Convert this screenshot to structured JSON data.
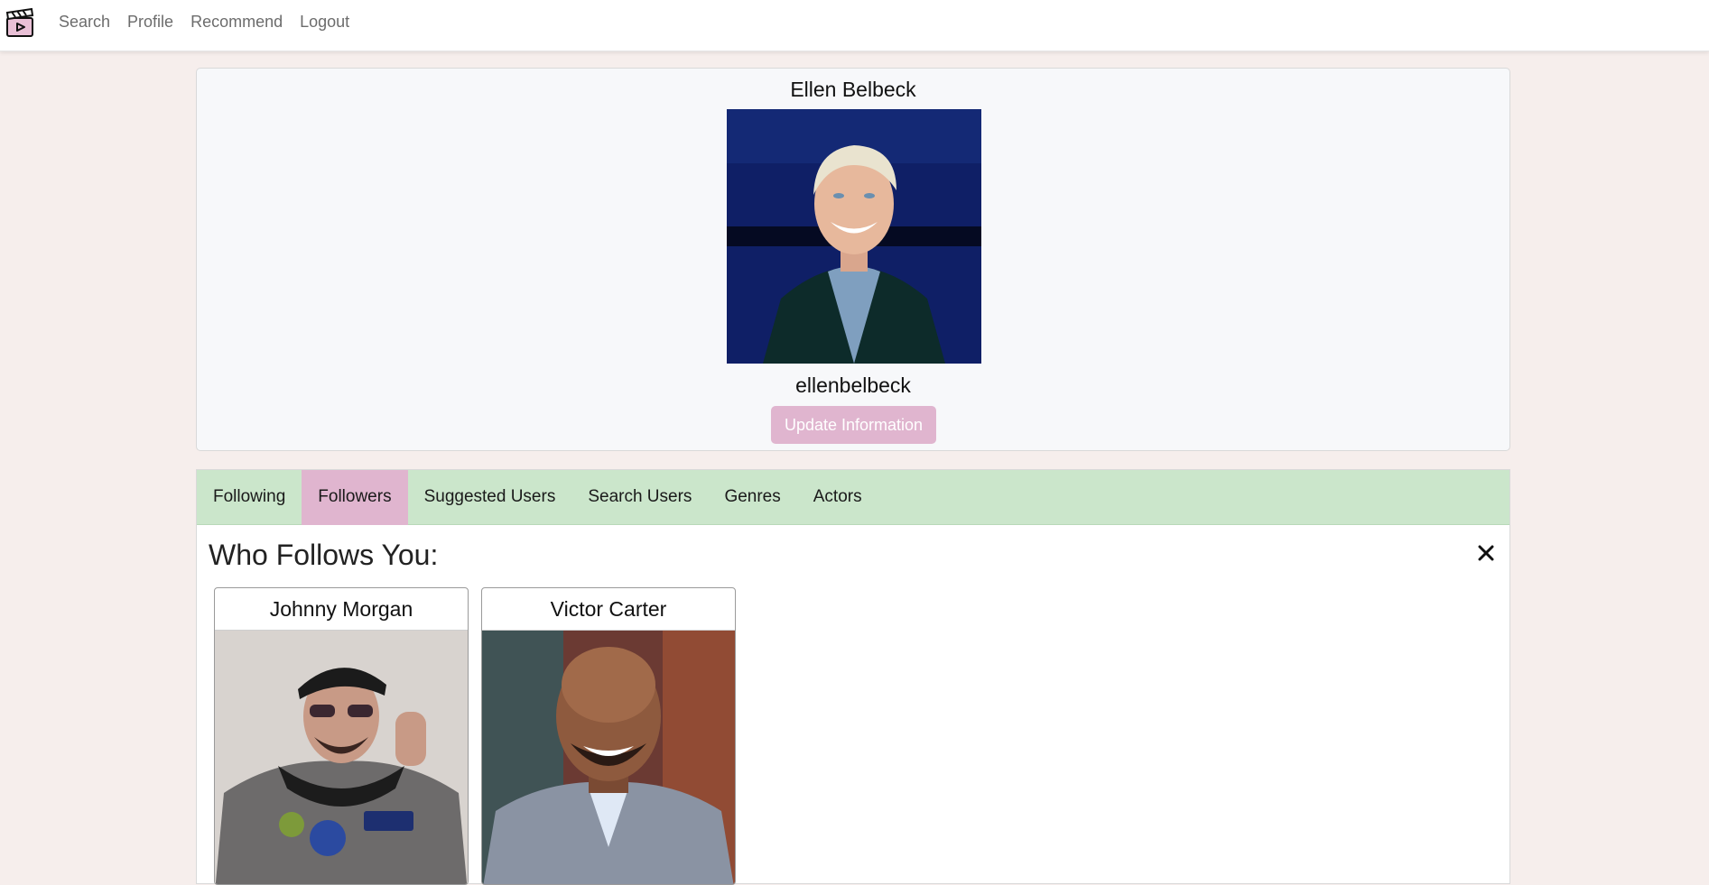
{
  "navbar": {
    "logo_icon": "clapperboard-play-icon",
    "links": [
      "Search",
      "Profile",
      "Recommend",
      "Logout"
    ]
  },
  "profile": {
    "name": "Ellen Belbeck",
    "username": "ellenbelbeck",
    "update_button": "Update Information"
  },
  "tabs": [
    {
      "label": "Following",
      "active": false
    },
    {
      "label": "Followers",
      "active": true
    },
    {
      "label": "Suggested Users",
      "active": false
    },
    {
      "label": "Search Users",
      "active": false
    },
    {
      "label": "Genres",
      "active": false
    },
    {
      "label": "Actors",
      "active": false
    }
  ],
  "followers_section": {
    "title": "Who Follows You:",
    "close_icon": "close-icon",
    "users": [
      {
        "name": "Johnny Morgan"
      },
      {
        "name": "Victor Carter"
      }
    ]
  },
  "colors": {
    "page_background": "#f6eeec",
    "accent_pink": "#e0b5cf",
    "tab_bar_green": "#cbe6cb"
  }
}
